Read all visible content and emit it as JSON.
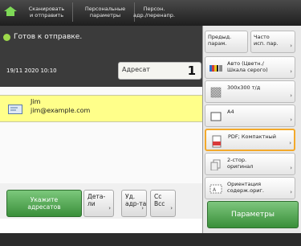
{
  "tabs": {
    "scan_send": "Сканировать\nи отправить",
    "personal": "Персональные\nпараметры",
    "address_book": "Персон.\nадр./перенапр."
  },
  "status": {
    "text": "Готов к отправке."
  },
  "datetime": "19/11 2020 10:10",
  "addressee": {
    "label": "Адресат",
    "count": "1"
  },
  "recipient": {
    "name": "Jim",
    "email": "jim@example.com"
  },
  "bottom": {
    "specify": "Укажите\nадресатов",
    "details": "Дета-\nли",
    "delete": "Уд.\nадр-та",
    "cc_bcc": "Сс\nВсс"
  },
  "right": {
    "prev": "Предыд.\nпарам.",
    "freq": "Часто\nисп. пар.",
    "color": "Авто (Цветн./\nШкала серого)",
    "resolution": "300x300 т/д",
    "size": "A4",
    "format": "PDF; Компактный",
    "duplex": "2-стор.\nоригинал",
    "orientation": "Ориентация\nсодерж.ориг.",
    "params": "Параметры"
  }
}
